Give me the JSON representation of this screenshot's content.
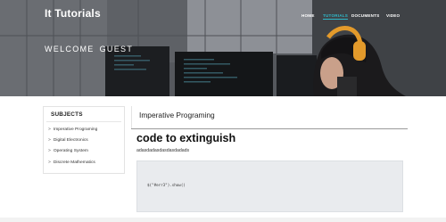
{
  "header": {
    "brand": "It Tutorials",
    "nav": [
      {
        "label": "HOME",
        "active": false
      },
      {
        "label": "TUTORIALS",
        "active": true
      },
      {
        "label": "DOCUMENTS",
        "active": false
      },
      {
        "label": "VIDEO",
        "active": false
      }
    ],
    "welcome_word": "WELCOME",
    "user_word": "GUEST"
  },
  "sidebar": {
    "title": "SUBJECTS",
    "items": [
      {
        "label": "Imperative Programing"
      },
      {
        "label": "Digital Electronics"
      },
      {
        "label": "Operating System"
      },
      {
        "label": "Discrete Mathematics"
      }
    ]
  },
  "main": {
    "section_title": "Imperative Programing",
    "article_title": "code to extinguish",
    "article_body": "adasdadasdasdasdadads",
    "code": "$(\"#err3\").show()"
  },
  "colors": {
    "accent": "#2fb8c9",
    "headphones": "#e39a2b"
  }
}
